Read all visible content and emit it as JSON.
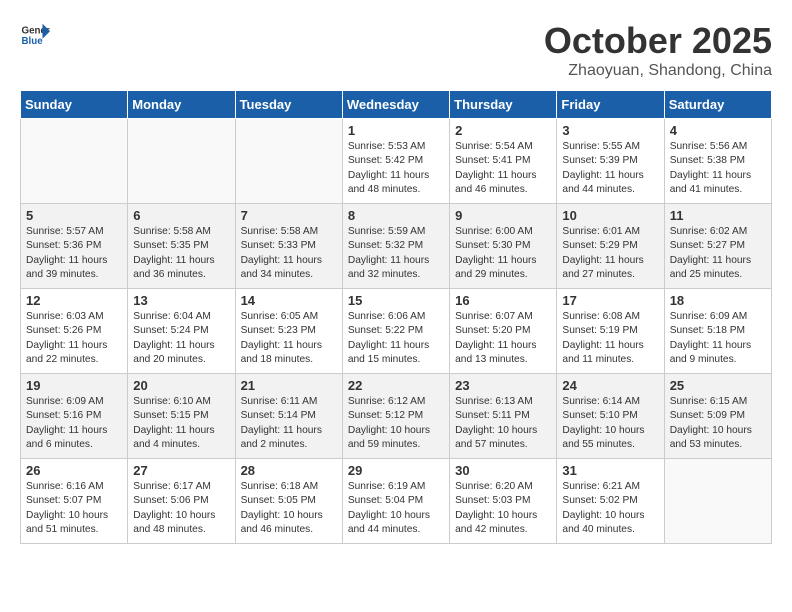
{
  "header": {
    "logo_line1": "General",
    "logo_line2": "Blue",
    "month": "October 2025",
    "location": "Zhaoyuan, Shandong, China"
  },
  "weekdays": [
    "Sunday",
    "Monday",
    "Tuesday",
    "Wednesday",
    "Thursday",
    "Friday",
    "Saturday"
  ],
  "weeks": [
    [
      {
        "day": "",
        "text": ""
      },
      {
        "day": "",
        "text": ""
      },
      {
        "day": "",
        "text": ""
      },
      {
        "day": "1",
        "text": "Sunrise: 5:53 AM\nSunset: 5:42 PM\nDaylight: 11 hours\nand 48 minutes."
      },
      {
        "day": "2",
        "text": "Sunrise: 5:54 AM\nSunset: 5:41 PM\nDaylight: 11 hours\nand 46 minutes."
      },
      {
        "day": "3",
        "text": "Sunrise: 5:55 AM\nSunset: 5:39 PM\nDaylight: 11 hours\nand 44 minutes."
      },
      {
        "day": "4",
        "text": "Sunrise: 5:56 AM\nSunset: 5:38 PM\nDaylight: 11 hours\nand 41 minutes."
      }
    ],
    [
      {
        "day": "5",
        "text": "Sunrise: 5:57 AM\nSunset: 5:36 PM\nDaylight: 11 hours\nand 39 minutes."
      },
      {
        "day": "6",
        "text": "Sunrise: 5:58 AM\nSunset: 5:35 PM\nDaylight: 11 hours\nand 36 minutes."
      },
      {
        "day": "7",
        "text": "Sunrise: 5:58 AM\nSunset: 5:33 PM\nDaylight: 11 hours\nand 34 minutes."
      },
      {
        "day": "8",
        "text": "Sunrise: 5:59 AM\nSunset: 5:32 PM\nDaylight: 11 hours\nand 32 minutes."
      },
      {
        "day": "9",
        "text": "Sunrise: 6:00 AM\nSunset: 5:30 PM\nDaylight: 11 hours\nand 29 minutes."
      },
      {
        "day": "10",
        "text": "Sunrise: 6:01 AM\nSunset: 5:29 PM\nDaylight: 11 hours\nand 27 minutes."
      },
      {
        "day": "11",
        "text": "Sunrise: 6:02 AM\nSunset: 5:27 PM\nDaylight: 11 hours\nand 25 minutes."
      }
    ],
    [
      {
        "day": "12",
        "text": "Sunrise: 6:03 AM\nSunset: 5:26 PM\nDaylight: 11 hours\nand 22 minutes."
      },
      {
        "day": "13",
        "text": "Sunrise: 6:04 AM\nSunset: 5:24 PM\nDaylight: 11 hours\nand 20 minutes."
      },
      {
        "day": "14",
        "text": "Sunrise: 6:05 AM\nSunset: 5:23 PM\nDaylight: 11 hours\nand 18 minutes."
      },
      {
        "day": "15",
        "text": "Sunrise: 6:06 AM\nSunset: 5:22 PM\nDaylight: 11 hours\nand 15 minutes."
      },
      {
        "day": "16",
        "text": "Sunrise: 6:07 AM\nSunset: 5:20 PM\nDaylight: 11 hours\nand 13 minutes."
      },
      {
        "day": "17",
        "text": "Sunrise: 6:08 AM\nSunset: 5:19 PM\nDaylight: 11 hours\nand 11 minutes."
      },
      {
        "day": "18",
        "text": "Sunrise: 6:09 AM\nSunset: 5:18 PM\nDaylight: 11 hours\nand 9 minutes."
      }
    ],
    [
      {
        "day": "19",
        "text": "Sunrise: 6:09 AM\nSunset: 5:16 PM\nDaylight: 11 hours\nand 6 minutes."
      },
      {
        "day": "20",
        "text": "Sunrise: 6:10 AM\nSunset: 5:15 PM\nDaylight: 11 hours\nand 4 minutes."
      },
      {
        "day": "21",
        "text": "Sunrise: 6:11 AM\nSunset: 5:14 PM\nDaylight: 11 hours\nand 2 minutes."
      },
      {
        "day": "22",
        "text": "Sunrise: 6:12 AM\nSunset: 5:12 PM\nDaylight: 10 hours\nand 59 minutes."
      },
      {
        "day": "23",
        "text": "Sunrise: 6:13 AM\nSunset: 5:11 PM\nDaylight: 10 hours\nand 57 minutes."
      },
      {
        "day": "24",
        "text": "Sunrise: 6:14 AM\nSunset: 5:10 PM\nDaylight: 10 hours\nand 55 minutes."
      },
      {
        "day": "25",
        "text": "Sunrise: 6:15 AM\nSunset: 5:09 PM\nDaylight: 10 hours\nand 53 minutes."
      }
    ],
    [
      {
        "day": "26",
        "text": "Sunrise: 6:16 AM\nSunset: 5:07 PM\nDaylight: 10 hours\nand 51 minutes."
      },
      {
        "day": "27",
        "text": "Sunrise: 6:17 AM\nSunset: 5:06 PM\nDaylight: 10 hours\nand 48 minutes."
      },
      {
        "day": "28",
        "text": "Sunrise: 6:18 AM\nSunset: 5:05 PM\nDaylight: 10 hours\nand 46 minutes."
      },
      {
        "day": "29",
        "text": "Sunrise: 6:19 AM\nSunset: 5:04 PM\nDaylight: 10 hours\nand 44 minutes."
      },
      {
        "day": "30",
        "text": "Sunrise: 6:20 AM\nSunset: 5:03 PM\nDaylight: 10 hours\nand 42 minutes."
      },
      {
        "day": "31",
        "text": "Sunrise: 6:21 AM\nSunset: 5:02 PM\nDaylight: 10 hours\nand 40 minutes."
      },
      {
        "day": "",
        "text": ""
      }
    ]
  ]
}
